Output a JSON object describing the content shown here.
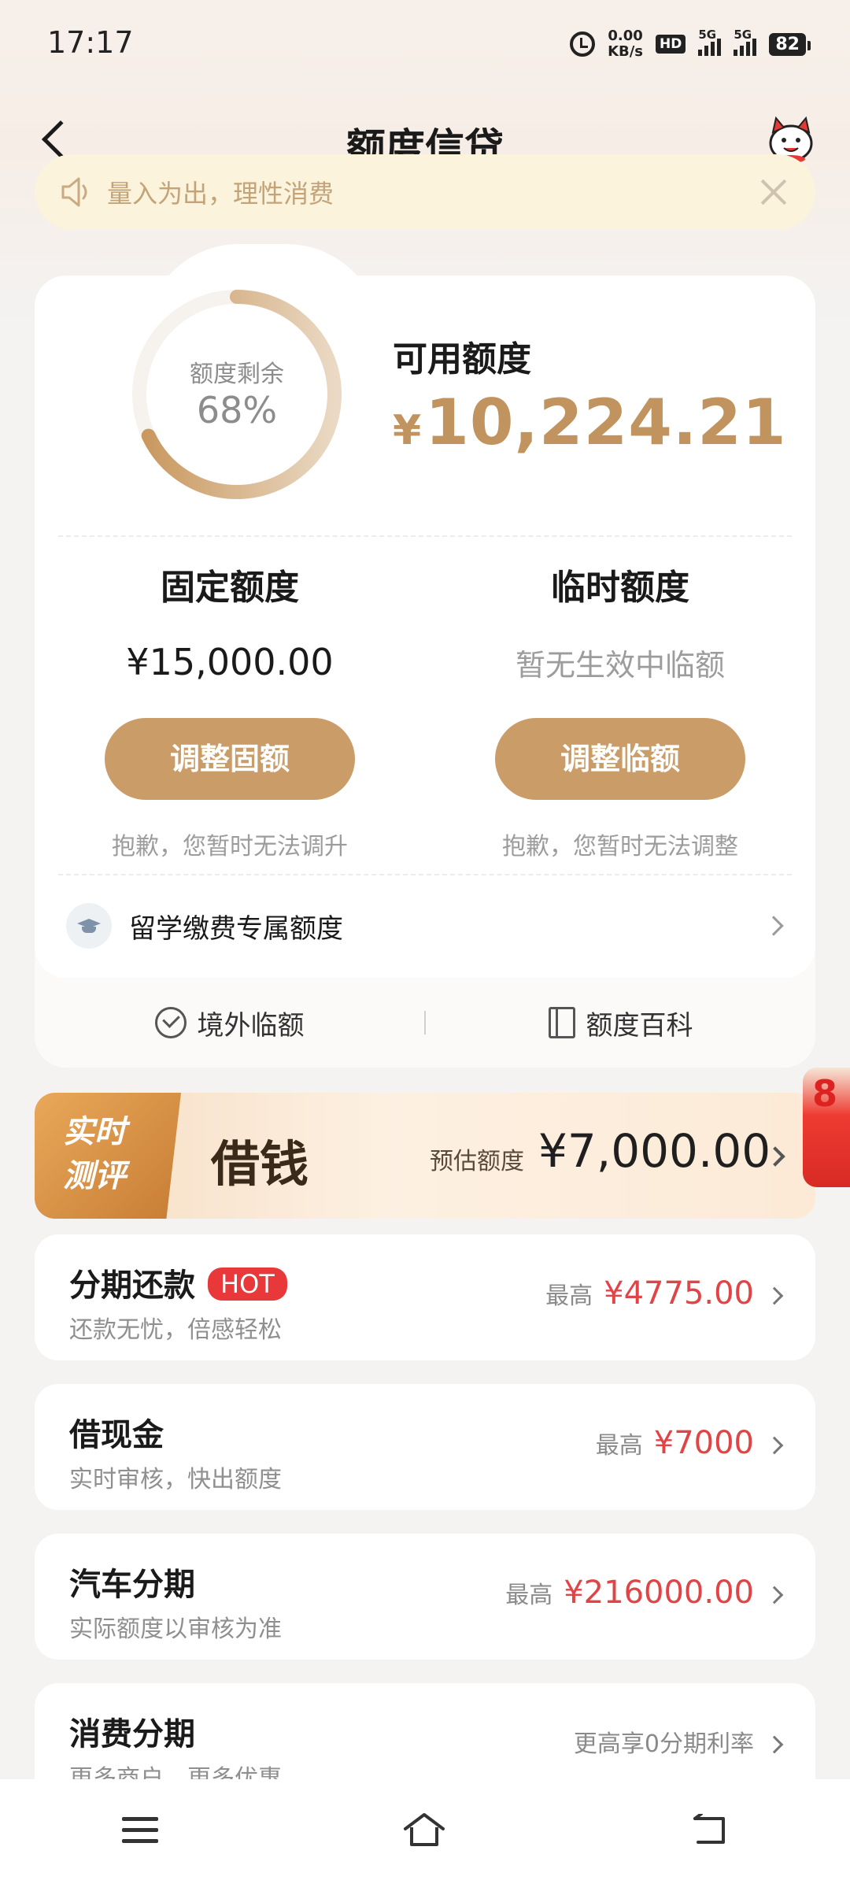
{
  "status_bar": {
    "time": "17:17",
    "net_speed_value": "0.00",
    "net_speed_unit": "KB/s",
    "hd": "HD",
    "signal1": "5G",
    "signal2": "5G",
    "battery": "82"
  },
  "nav": {
    "title": "额度信贷"
  },
  "notice": {
    "text": "量入为出，理性消费"
  },
  "credit": {
    "ring_label": "额度剩余",
    "ring_percent_text": "68%",
    "ring_fraction": 0.68,
    "available_label": "可用额度",
    "available_currency": "¥",
    "available_amount": "10,224.21",
    "fixed": {
      "title": "固定额度",
      "amount": "¥15,000.00",
      "button": "调整固额",
      "note": "抱歉，您暂时无法调升"
    },
    "temp": {
      "title": "临时额度",
      "amount": "暂无生效中临额",
      "button": "调整临额",
      "note": "抱歉，您暂时无法调整"
    },
    "study_label": "留学缴费专属额度",
    "links": {
      "overseas": "境外临额",
      "wiki": "额度百科"
    }
  },
  "banner": {
    "tag_line1": "实时",
    "tag_line2": "测评",
    "title": "借钱",
    "estimate_label": "预估额度",
    "estimate_value": "¥7,000.00",
    "red_packet_digit": "8"
  },
  "products": [
    {
      "name": "分期还款",
      "badge": "HOT",
      "sub": "还款无忧，倍感轻松",
      "max_label": "最高",
      "max_value": "¥4775.00"
    },
    {
      "name": "借现金",
      "sub": "实时审核，快出额度",
      "max_label": "最高",
      "max_value": "¥7000"
    },
    {
      "name": "汽车分期",
      "sub": "实际额度以审核为准",
      "max_label": "最高",
      "max_value": "¥216000.00"
    },
    {
      "name": "消费分期",
      "sub": "更多商户，更多优惠",
      "right_text": "更高享0分期利率"
    }
  ],
  "colors": {
    "accent_gold": "#c1935e",
    "button_gold": "#c99c68",
    "price_red": "#e04446",
    "hot_red": "#e8383a"
  }
}
